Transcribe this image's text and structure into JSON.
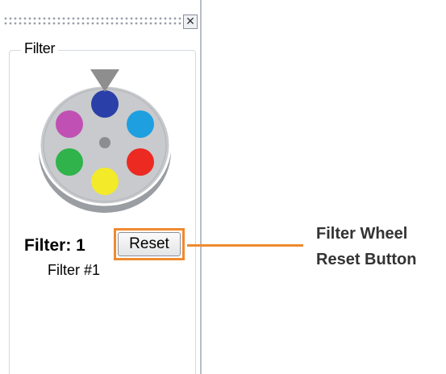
{
  "panel": {
    "close_icon_glyph": "✕",
    "group_title": "Filter",
    "filter_label": "Filter: 1",
    "reset_button_label": "Reset",
    "filter_name": "Filter #1"
  },
  "wheel": {
    "indicator_color": "#8e8e8e",
    "disc_color": "#c8cacd",
    "positions": [
      {
        "name": "blue",
        "color": "#2b3fa8"
      },
      {
        "name": "cyan",
        "color": "#1e9fe0"
      },
      {
        "name": "red",
        "color": "#ec2a22"
      },
      {
        "name": "yellow",
        "color": "#f3ea2a"
      },
      {
        "name": "green",
        "color": "#2fb34a"
      },
      {
        "name": "magenta",
        "color": "#c050b4"
      }
    ]
  },
  "callout": {
    "line1": "Filter Wheel",
    "line2": "Reset Button",
    "color": "#ef8a2f"
  }
}
